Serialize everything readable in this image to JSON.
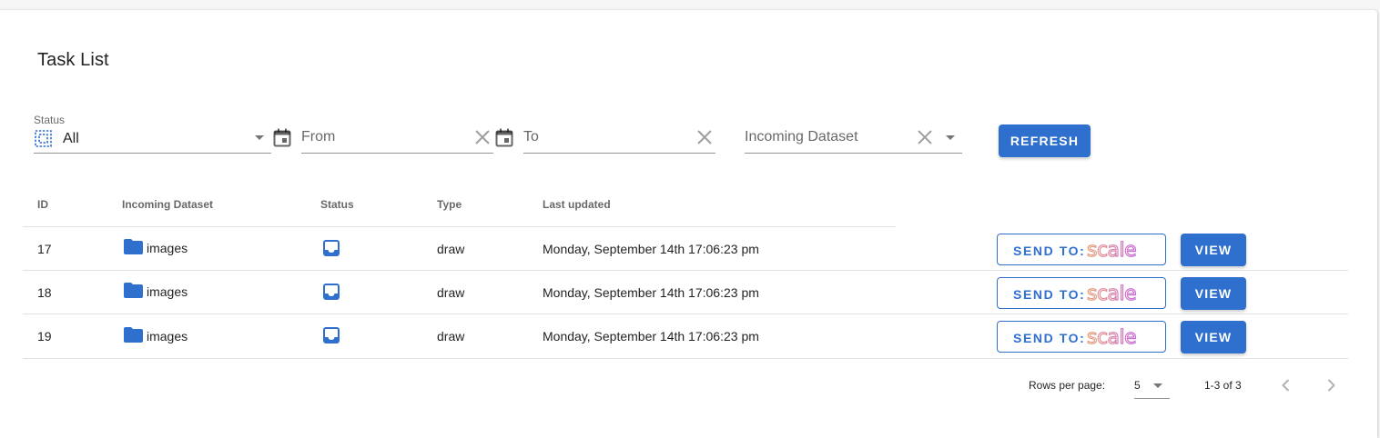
{
  "page": {
    "title": "Task List"
  },
  "filters": {
    "status": {
      "label": "Status",
      "value": "All",
      "icon": "dashed-square-icon"
    },
    "from": {
      "placeholder": "From"
    },
    "to": {
      "placeholder": "To"
    },
    "dataset": {
      "placeholder": "Incoming Dataset"
    },
    "refresh_label": "REFRESH"
  },
  "table": {
    "columns": [
      "ID",
      "Incoming Dataset",
      "Status",
      "Type",
      "Last updated"
    ],
    "rows": [
      {
        "id": "17",
        "dataset": "images",
        "status_icon": "inbox-icon",
        "type": "draw",
        "last_updated": "Monday, September 14th 17:06:23 pm",
        "send_label": "SEND TO:",
        "send_logo": "scale",
        "view_label": "VIEW"
      },
      {
        "id": "18",
        "dataset": "images",
        "status_icon": "inbox-icon",
        "type": "draw",
        "last_updated": "Monday, September 14th 17:06:23 pm",
        "send_label": "SEND TO:",
        "send_logo": "scale",
        "view_label": "VIEW"
      },
      {
        "id": "19",
        "dataset": "images",
        "status_icon": "inbox-icon",
        "type": "draw",
        "last_updated": "Monday, September 14th 17:06:23 pm",
        "send_label": "SEND TO:",
        "send_logo": "scale",
        "view_label": "VIEW"
      }
    ]
  },
  "pagination": {
    "rows_per_page_label": "Rows per page:",
    "rows_per_page_value": "5",
    "range_text": "1-3 of 3"
  },
  "colors": {
    "primary": "#2f6fce",
    "folder": "#2f6fce",
    "scale_gradient": [
      "#e8a07a",
      "#c86ad8"
    ]
  }
}
